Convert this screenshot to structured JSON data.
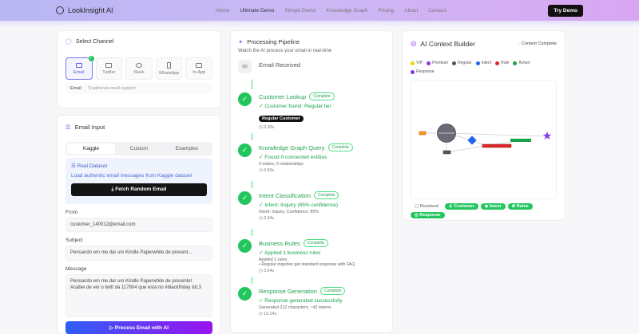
{
  "header": {
    "brand": "LookInsight AI",
    "nav": [
      "Home",
      "Ultimate Demo",
      "Simple Demo",
      "Knowledge Graph",
      "Pricing",
      "About",
      "Contact"
    ],
    "cta": "Try Demo"
  },
  "channel": {
    "title": "Select Channel",
    "options": [
      "Email",
      "Twitter",
      "Slack",
      "WhatsApp",
      "In-App"
    ],
    "selected_name": "Email",
    "selected_desc": "Traditional email support"
  },
  "input": {
    "title": "Email Input",
    "tabs": [
      "Kaggle",
      "Custom",
      "Examples"
    ],
    "dataset_title": "Real Dataset",
    "dataset_desc": "Load authentic email messages from Kaggle dataset",
    "fetch": "Fetch Random Email",
    "from_label": "From",
    "from": "customer_140012@email.com",
    "subject_label": "Subject",
    "subject": "Pensando em me dar um Kindle Paperwhite de present...",
    "message_label": "Message",
    "message": "Pensando em me dar um Kindle Paperwhite de presente! Acabei de ver o twitt da 117804 que está no #blackfriday &lt;3",
    "process": "Process Email with AI"
  },
  "pipeline": {
    "title": "Processing Pipeline",
    "subtitle": "Watch the AI process your email in real-time",
    "received": "Email Received",
    "steps": [
      {
        "name": "Customer Lookup",
        "status": "Complete",
        "result": "✓ Customer found: Regular tier",
        "tag": "Regular Customer",
        "meta": "",
        "time": "0.30s"
      },
      {
        "name": "Knowledge Graph Query",
        "status": "Complete",
        "result": "✓ Found 0 connected entities",
        "meta": "0 nodes, 0 relationships",
        "time": "0.60s"
      },
      {
        "name": "Intent Classification",
        "status": "Complete",
        "result": "✓ Intent: Inquiry (85% confidence)",
        "meta": "Intent: Inquiry, Confidence: 85%",
        "time": "3.34s"
      },
      {
        "name": "Business Rules",
        "status": "Complete",
        "result": "✓ Applied 1 business rules",
        "meta": "Applied 1 rules:",
        "meta2": "• Regular inquiries get standard response with FAQ",
        "time": "3.64s"
      },
      {
        "name": "Response Generation",
        "status": "Complete",
        "result": "✓ Response generated successfully",
        "meta": "Generated 212 characters, ~42 tokens",
        "time": "10.14s"
      }
    ]
  },
  "context": {
    "title": "AI Context Builder",
    "status": "Context Complete",
    "legend": [
      {
        "label": "VIP",
        "color": "#facc15"
      },
      {
        "label": "Premium",
        "color": "#9333ea"
      },
      {
        "label": "Regular",
        "color": "#555555"
      },
      {
        "label": "Intent",
        "color": "#2563eb"
      },
      {
        "label": "Rule",
        "color": "#dc2626"
      },
      {
        "label": "Action",
        "color": "#16a34a"
      },
      {
        "label": "Response",
        "color": "#7c3aed"
      }
    ],
    "chips": [
      "Received",
      "Customer",
      "Intent",
      "Rules",
      "Response"
    ]
  }
}
